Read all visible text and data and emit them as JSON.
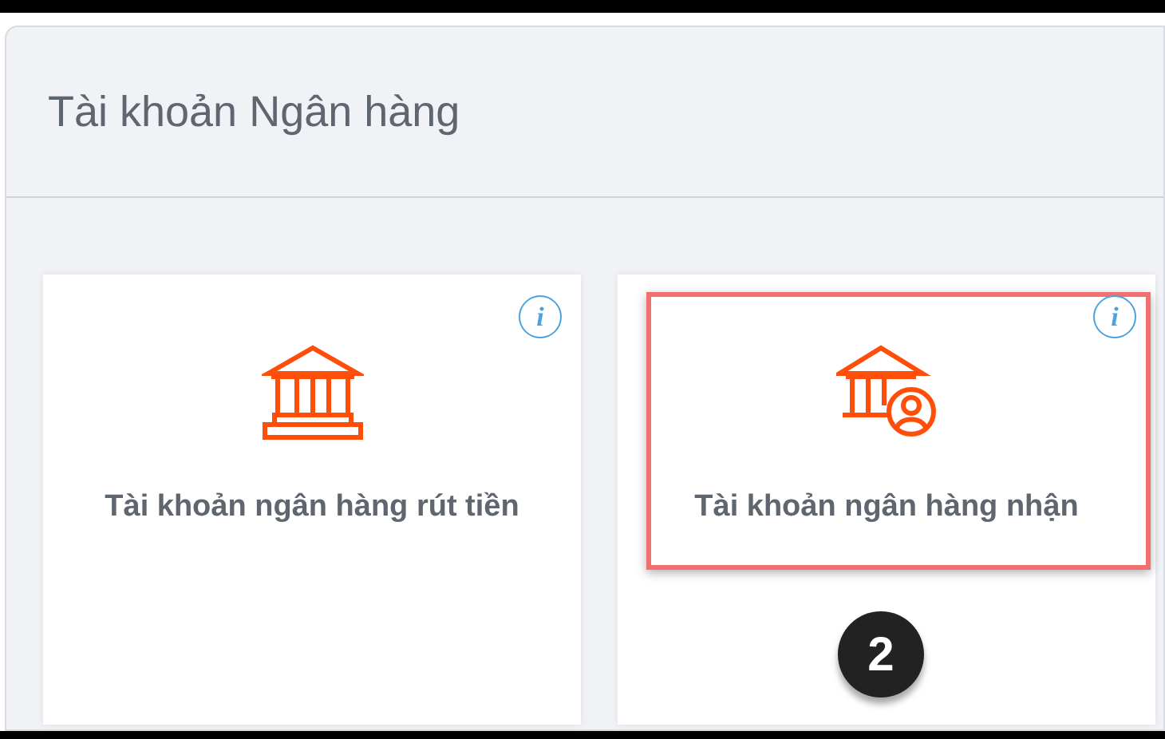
{
  "panel": {
    "title": "Tài khoản Ngân hàng"
  },
  "cards": [
    {
      "kind": "bank",
      "label": "Tài khoản ngân hàng rút tiền",
      "info": "i",
      "highlighted": false
    },
    {
      "kind": "bank-user",
      "label": "Tài khoản ngân hàng nhận",
      "info": "i",
      "highlighted": true,
      "step": "2"
    }
  ]
}
